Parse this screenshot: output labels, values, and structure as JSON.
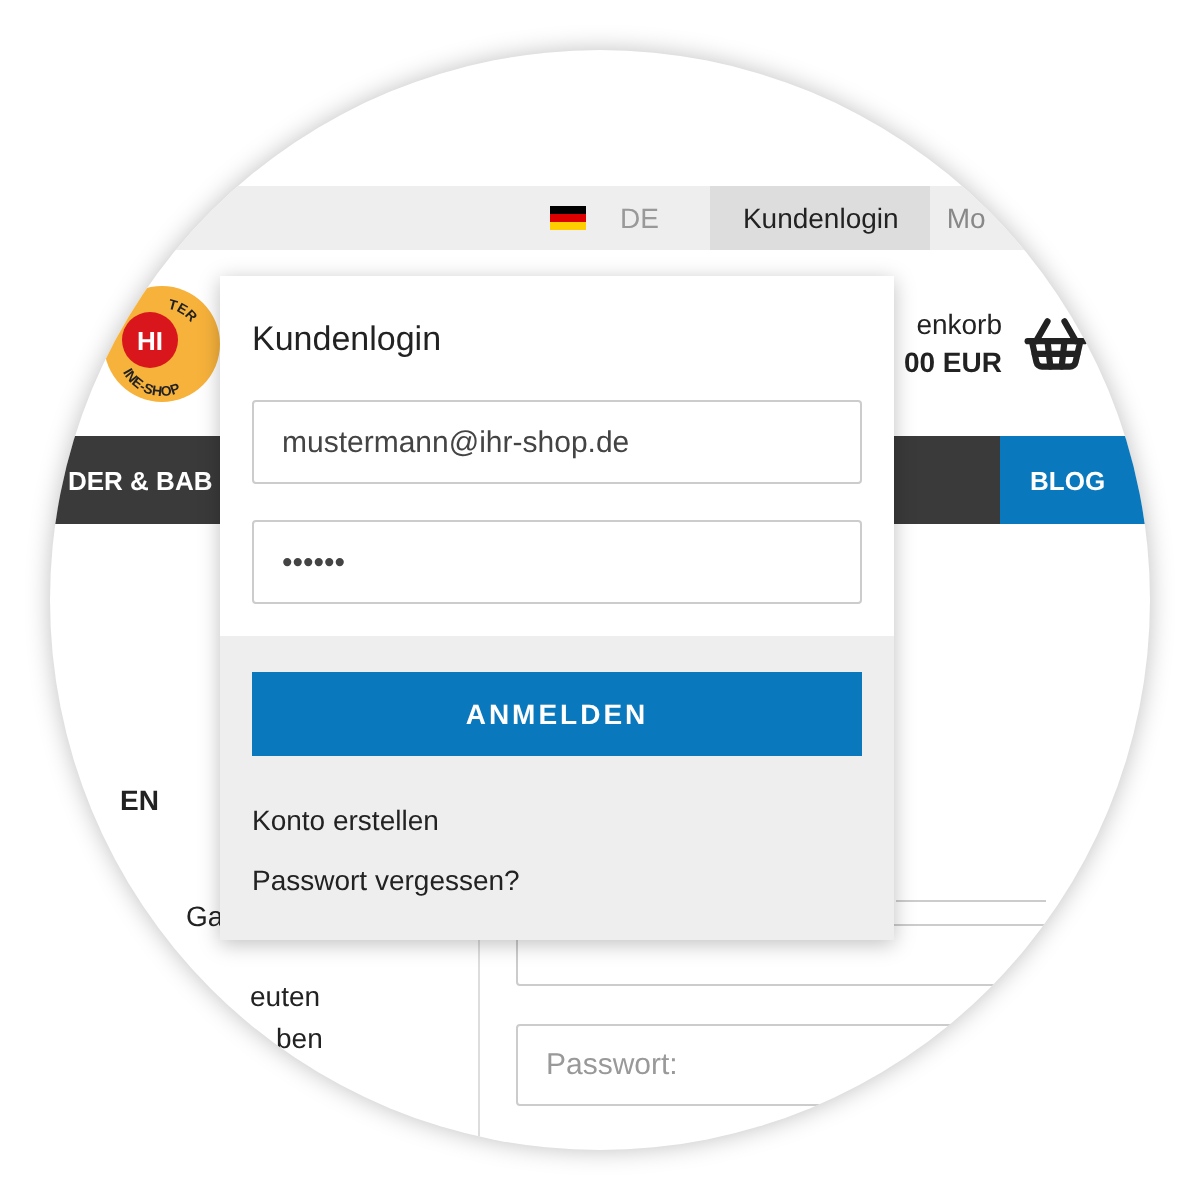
{
  "top_bar": {
    "language": "DE",
    "tabs": [
      {
        "label": "Kundenlogin",
        "selected": true
      },
      {
        "label": "Mo",
        "selected": false
      }
    ]
  },
  "header": {
    "logo": {
      "center": "HI",
      "top": "TER",
      "bottom": "INE-SHOP"
    },
    "cart_label": "enkorb",
    "cart_total": "00 EUR"
  },
  "nav": {
    "items": [
      {
        "label": "DER & BAB",
        "highlighted": false
      },
      {
        "label": "BLOG",
        "highlighted": true
      }
    ]
  },
  "sidebar": {
    "heading": "EN",
    "items": [
      "Ga",
      "euten",
      "ben"
    ]
  },
  "login_form": {
    "password_placeholder": "Passwort:"
  },
  "login_popup": {
    "title": "Kundenlogin",
    "email": "mustermann@ihr-shop.de",
    "password": "••••••",
    "submit": "ANMELDEN",
    "links": [
      "Konto erstellen",
      "Passwort vergessen?"
    ]
  }
}
